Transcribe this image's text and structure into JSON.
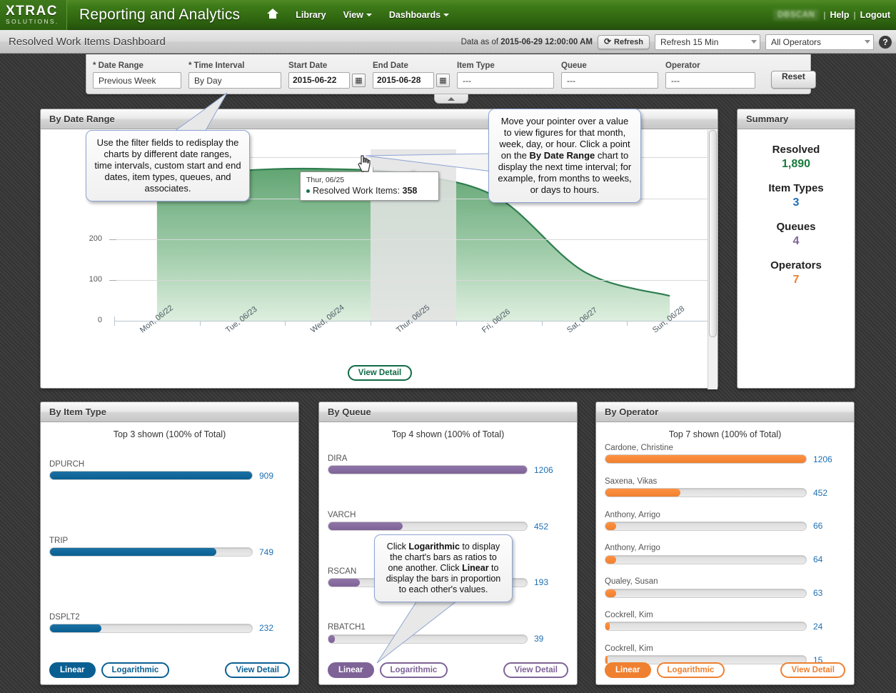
{
  "header": {
    "logo_line1": "XTRAC",
    "logo_line2": "SOLUTIONS.",
    "app_title": "Reporting and Analytics",
    "nav": [
      {
        "label": "Library",
        "caret": false
      },
      {
        "label": "View",
        "caret": true
      },
      {
        "label": "Dashboards",
        "caret": true
      }
    ],
    "user": "DBSCAN",
    "help": "Help",
    "logout": "Logout",
    "separator": "|"
  },
  "subheader": {
    "dashboard_title": "Resolved Work Items Dashboard",
    "data_as_of_label": "Data as of",
    "data_as_of_value": "2015-06-29 12:00:00 AM",
    "refresh_button": "Refresh",
    "refresh_interval": "Refresh 15 Min",
    "operator_filter": "All Operators",
    "help_icon_label": "?"
  },
  "filters": {
    "date_range": {
      "label": "* Date Range",
      "value": "Previous Week"
    },
    "time_interval": {
      "label": "* Time Interval",
      "value": "By Day"
    },
    "start_date": {
      "label": "Start Date",
      "value": "2015-06-22"
    },
    "end_date": {
      "label": "End Date",
      "value": "2015-06-28"
    },
    "item_type": {
      "label": "Item Type",
      "value": "---"
    },
    "queue": {
      "label": "Queue",
      "value": "---"
    },
    "operator": {
      "label": "Operator",
      "value": "---"
    },
    "reset_button": "Reset"
  },
  "chart_panel": {
    "title": "By Date Range",
    "view_detail": "View Detail"
  },
  "chart_data": {
    "type": "area",
    "title": "By Date Range",
    "xlabel": "",
    "ylabel": "",
    "categories": [
      "Mon, 06/22",
      "Tue, 06/23",
      "Wed, 06/24",
      "Thur, 06/25",
      "Fri, 06/26",
      "Sat, 06/27",
      "Sun, 06/28"
    ],
    "series": [
      {
        "name": "Resolved Work Items",
        "values": [
          345,
          368,
          372,
          358,
          300,
          120,
          61
        ]
      }
    ],
    "ylim": [
      0,
      420
    ],
    "yticks": [
      0,
      100,
      200,
      300,
      400
    ],
    "grid": true,
    "legend": "none",
    "color": "#2f7d4f",
    "tooltip": {
      "date": "Thur, 06/25",
      "series_label": "Resolved Work Items",
      "value": "358"
    }
  },
  "summary": {
    "title": "Summary",
    "items": [
      {
        "label": "Resolved",
        "value": "1,890",
        "color": "#1a7a3c"
      },
      {
        "label": "Item Types",
        "value": "3",
        "color": "#1f6fb2"
      },
      {
        "label": "Queues",
        "value": "4",
        "color": "#7e6397"
      },
      {
        "label": "Operators",
        "value": "7",
        "color": "#ef8030"
      }
    ]
  },
  "item_type_panel": {
    "title": "By Item Type",
    "subtitle": "Top 3 shown (100% of Total)",
    "color": "#0a5f92",
    "linear_label": "Linear",
    "log_label": "Logarithmic",
    "view_detail": "View Detail",
    "chart_data": {
      "type": "bar",
      "title": "By Item Type",
      "categories": [
        "DPURCH",
        "TRIP",
        "DSPLT2"
      ],
      "values": [
        909,
        749,
        232
      ],
      "max": 909,
      "orientation": "horizontal",
      "scale": "linear"
    }
  },
  "queue_panel": {
    "title": "By Queue",
    "subtitle": "Top 4 shown (100% of Total)",
    "color": "#7e6397",
    "linear_label": "Linear",
    "log_label": "Logarithmic",
    "view_detail": "View Detail",
    "chart_data": {
      "type": "bar",
      "title": "By Queue",
      "categories": [
        "DIRA",
        "VARCH",
        "RSCAN",
        "RBATCH1"
      ],
      "values": [
        1206,
        452,
        193,
        39
      ],
      "max": 1206,
      "orientation": "horizontal",
      "scale": "linear"
    }
  },
  "operator_panel": {
    "title": "By Operator",
    "subtitle": "Top 7 shown (100% of Total)",
    "color": "#ef8030",
    "linear_label": "Linear",
    "log_label": "Logarithmic",
    "view_detail": "View Detail",
    "chart_data": {
      "type": "bar",
      "title": "By Operator",
      "categories": [
        "Cardone, Christine",
        "Saxena, Vikas",
        "Anthony, Arrigo",
        "Anthony, Arrigo",
        "Qualey, Susan",
        "Cockrell, Kim",
        "Cockrell, Kim"
      ],
      "values": [
        1206,
        452,
        66,
        64,
        63,
        24,
        15
      ],
      "max": 1206,
      "orientation": "horizontal",
      "scale": "linear"
    }
  },
  "callouts": {
    "filters": "Use the filter fields to redisplay the charts by different date ranges, time intervals, custom start and end dates, item types, queues, and associates.",
    "hover": {
      "part1": "Move your pointer over a value to view figures for that month, week, day, or hour. Click a point on the ",
      "bold1": "By Date Range",
      "part2": " chart to display the next time interval; for example, from months to weeks, or days to hours."
    },
    "scale": {
      "part1": "Click ",
      "bold1": "Logarithmic",
      "part2": " to display the chart's bars as ratios to one another. Click ",
      "bold2": "Linear",
      "part3": " to display the bars in proportion to each other's values."
    }
  }
}
